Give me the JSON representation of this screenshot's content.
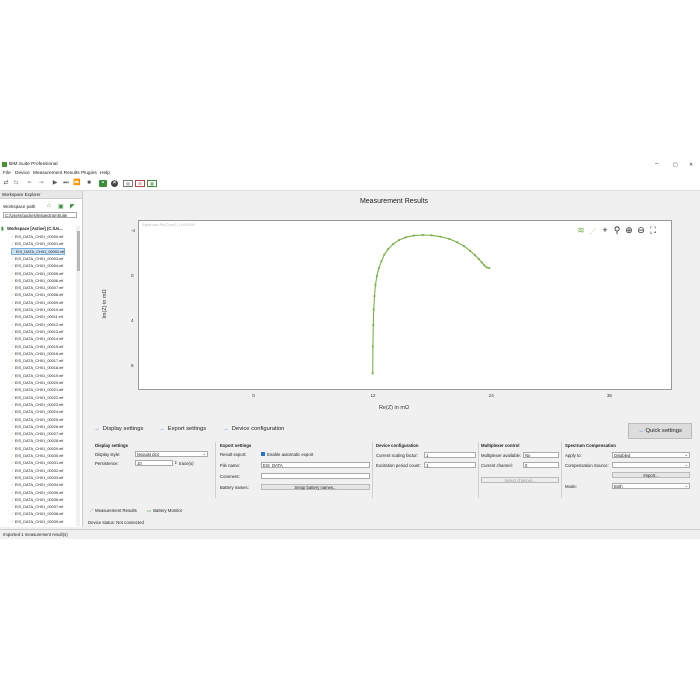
{
  "window": {
    "title": "BIM.Suite Professional",
    "controls": [
      "–",
      "▢",
      "✕"
    ]
  },
  "menu": [
    "File",
    "Device",
    "Measurement Results",
    "Plugins",
    "Help"
  ],
  "toolbar": {
    "icons": [
      "connect-icon",
      "disconnect-icon",
      "step-back-icon",
      "step-forward-icon",
      "play-icon",
      "skip-icon",
      "fast-forward-icon",
      "stop-icon",
      "save-icon",
      "cancel-icon",
      "table-icon",
      "export-icon",
      "report-icon"
    ]
  },
  "sidebar": {
    "header": "Workspace Explorer",
    "workspace_label": "Workspace path",
    "workspace_path": "C:/Users/guckes/InspectrumSuite",
    "root": "Workspace [Active] (C:/Us...",
    "selected_index": 2,
    "files": [
      "EIS_DATA_CH01_00000.eif",
      "EIS_DATA_CH01_00001.eif",
      "EIS_DATA_CH01_00002.eif",
      "EIS_DATA_CH01_00003.eif",
      "EIS_DATA_CH01_00004.eif",
      "EIS_DATA_CH01_00005.eif",
      "EIS_DATA_CH01_00006.eif",
      "EIS_DATA_CH01_00007.eif",
      "EIS_DATA_CH01_00008.eif",
      "EIS_DATA_CH01_00009.eif",
      "EIS_DATA_CH01_00010.eif",
      "EIS_DATA_CH01_00011.eif",
      "EIS_DATA_CH01_00012.eif",
      "EIS_DATA_CH01_00013.eif",
      "EIS_DATA_CH01_00014.eif",
      "EIS_DATA_CH01_00015.eif",
      "EIS_DATA_CH01_00016.eif",
      "EIS_DATA_CH01_00017.eif",
      "EIS_DATA_CH01_00018.eif",
      "EIS_DATA_CH01_00019.eif",
      "EIS_DATA_CH01_00020.eif",
      "EIS_DATA_CH01_00021.eif",
      "EIS_DATA_CH01_00022.eif",
      "EIS_DATA_CH01_00023.eif",
      "EIS_DATA_CH01_00024.eif",
      "EIS_DATA_CH01_00025.eif",
      "EIS_DATA_CH01_00026.eif",
      "EIS_DATA_CH01_00027.eif",
      "EIS_DATA_CH01_00028.eif",
      "EIS_DATA_CH01_00029.eif",
      "EIS_DATA_CH01_00030.eif",
      "EIS_DATA_CH01_00031.eif",
      "EIS_DATA_CH01_00032.eif",
      "EIS_DATA_CH01_00033.eif",
      "EIS_DATA_CH01_00034.eif",
      "EIS_DATA_CH01_00035.eif",
      "EIS_DATA_CH01_00036.eif",
      "EIS_DATA_CH01_00037.eif",
      "EIS_DATA_CH01_00038.eif",
      "EIS_DATA_CH01_00039.eif"
    ]
  },
  "chart_data": {
    "type": "scatter",
    "title": "Measurement Results",
    "xlabel": "Re(Z) in mΩ",
    "ylabel": "Im(Z) in mΩ",
    "xlim": [
      -12,
      42
    ],
    "ylim": [
      10,
      -5
    ],
    "xticks": [
      0,
      12,
      24,
      36
    ],
    "yticks": [
      -4,
      0,
      4,
      8
    ],
    "yticks_labels": [
      "-4",
      "0",
      "4",
      "8"
    ],
    "grid": false,
    "line_color": "#7ab04a",
    "series": [
      {
        "x": [
          11.72,
          11.74,
          11.78,
          11.82,
          11.9,
          12.0,
          12.15,
          12.35,
          12.6,
          12.9,
          13.3,
          13.8,
          14.4,
          15.1,
          15.9,
          16.8,
          17.7,
          18.6,
          19.5,
          20.3,
          21.0,
          21.6,
          22.1,
          22.5,
          22.8,
          23.05,
          23.3,
          23.55
        ],
        "y": [
          8.6,
          6.2,
          4.3,
          2.9,
          1.7,
          0.7,
          -0.1,
          -0.8,
          -1.4,
          -2.0,
          -2.5,
          -2.95,
          -3.3,
          -3.55,
          -3.7,
          -3.75,
          -3.72,
          -3.6,
          -3.4,
          -3.1,
          -2.75,
          -2.35,
          -1.95,
          -1.6,
          -1.3,
          -1.05,
          -0.85,
          -0.8
        ]
      }
    ]
  },
  "chart_note": "Signal ratio Re(Z) Im(Z) 1.0000000",
  "chart_tools": [
    "legend-icon",
    "series-icon",
    "crosshair-icon",
    "search-icon",
    "zoom-in-icon",
    "zoom-out-icon",
    "fit-icon"
  ],
  "settings_tabs": [
    "Display settings",
    "Export settings",
    "Device configuration"
  ],
  "quick_settings": "Quick settings",
  "display": {
    "title": "Display settings",
    "style_label": "Display style:",
    "style_value": "Nyquist plot",
    "persistence_label": "Persistence:",
    "persistence_value": "10",
    "persistence_unit": "trace(s)"
  },
  "export": {
    "title": "Export settings",
    "result_label": "Result export:",
    "auto_label": "Enable automatic export",
    "auto_checked": true,
    "file_label": "File name:",
    "file_value": "EIS_DATA",
    "comment_label": "Comment:",
    "comment_value": "",
    "battery_label": "Battery names:",
    "battery_button": "Setup battery names..."
  },
  "device": {
    "title": "Device configuration",
    "scaling_label": "Current scaling factor:",
    "scaling_value": "1",
    "excitation_label": "Excitation period count:",
    "excitation_value": "1"
  },
  "mux": {
    "title": "Multiplexer control",
    "available_label": "Multiplexer available:",
    "available_value": "No",
    "channel_label": "Current channel:",
    "channel_value": "0",
    "select_button": "Select channel..."
  },
  "spectrum": {
    "title": "Spectrum Compensation",
    "apply_label": "Apply to:",
    "apply_value": "Disabled",
    "source_label": "Compensation Source:",
    "source_value": "",
    "import_button": "Import...",
    "mode_label": "Mode:",
    "mode_value": "Both"
  },
  "bottom_tabs": [
    "Measurement Results",
    "Battery Monitor"
  ],
  "device_status": "Device status:  Not connected",
  "status_bar": "Imported 1 measurement result(s)"
}
